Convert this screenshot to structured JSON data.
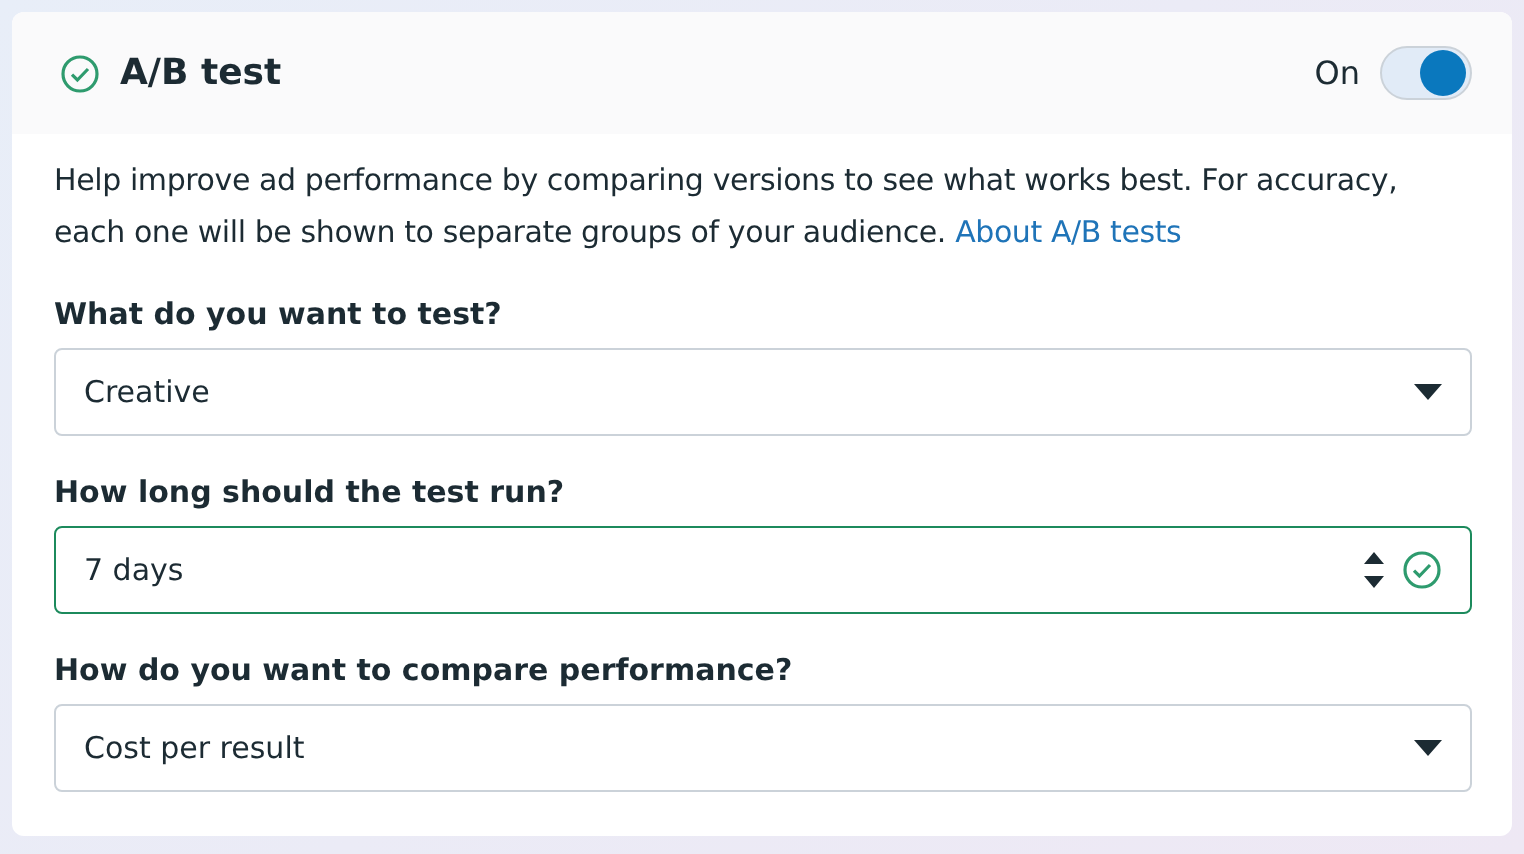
{
  "header": {
    "title": "A/B test",
    "complete": true,
    "toggle_label": "On",
    "toggle_on": true
  },
  "description": {
    "text": "Help improve ad performance by comparing versions to see what works best. For accuracy, each one will be shown to separate groups of your audience.",
    "link": "About A/B tests"
  },
  "fields": [
    {
      "label": "What do you want to test?",
      "kind": "select",
      "value": "Creative",
      "valid": false
    },
    {
      "label": "How long should the test run?",
      "kind": "number",
      "value": "7 days",
      "valid": true
    },
    {
      "label": "How do you want to compare performance?",
      "kind": "select",
      "value": "Cost per result",
      "valid": false
    }
  ]
}
